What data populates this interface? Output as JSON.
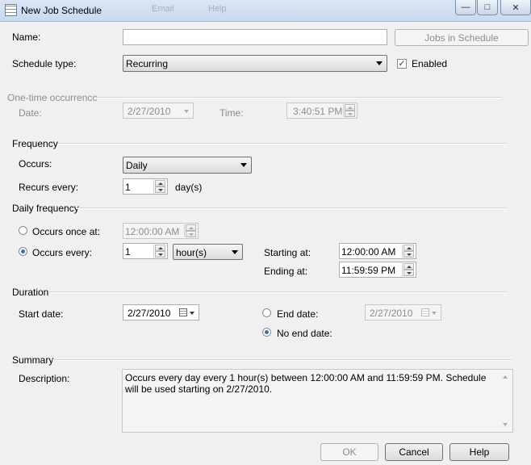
{
  "window": {
    "title": "New Job Schedule",
    "ghost_menu_1": "Email",
    "ghost_menu_2": "Help",
    "minimize_glyph": "—",
    "maximize_glyph": "□",
    "close_glyph": "✕"
  },
  "name": {
    "label": "Name:",
    "value": ""
  },
  "jobs_in_schedule_button": "Jobs in Schedule",
  "schedule_type": {
    "label": "Schedule type:",
    "value": "Recurring",
    "enabled_label": "Enabled",
    "enabled_checked": true
  },
  "one_time": {
    "header": "One-time occurrence",
    "date_label": "Date:",
    "date_value": "2/27/2010",
    "time_label": "Time:",
    "time_value": "3:40:51 PM"
  },
  "frequency": {
    "header": "Frequency",
    "occurs_label": "Occurs:",
    "occurs_value": "Daily",
    "recurs_label": "Recurs every:",
    "recurs_value": "1",
    "recurs_unit": "day(s)"
  },
  "daily_frequency": {
    "header": "Daily frequency",
    "once_label": "Occurs once at:",
    "once_value": "12:00:00 AM",
    "once_selected": false,
    "every_label": "Occurs every:",
    "every_value": "1",
    "every_unit": "hour(s)",
    "every_selected": true,
    "starting_label": "Starting at:",
    "starting_value": "12:00:00 AM",
    "ending_label": "Ending at:",
    "ending_value": "11:59:59 PM"
  },
  "duration": {
    "header": "Duration",
    "start_label": "Start date:",
    "start_value": "2/27/2010",
    "end_label": "End date:",
    "end_value": "2/27/2010",
    "end_selected": false,
    "no_end_label": "No end date:",
    "no_end_selected": true
  },
  "summary": {
    "header": "Summary",
    "description_label": "Description:",
    "description_text": "Occurs every day every 1 hour(s) between 12:00:00 AM and 11:59:59 PM. Schedule will be used starting on 2/27/2010."
  },
  "buttons": {
    "ok": "OK",
    "cancel": "Cancel",
    "help": "Help"
  },
  "colors": {
    "titlebar": "#c9d9ee",
    "background": "#f0f0f0",
    "radio_accent": "#3a6dbb"
  }
}
